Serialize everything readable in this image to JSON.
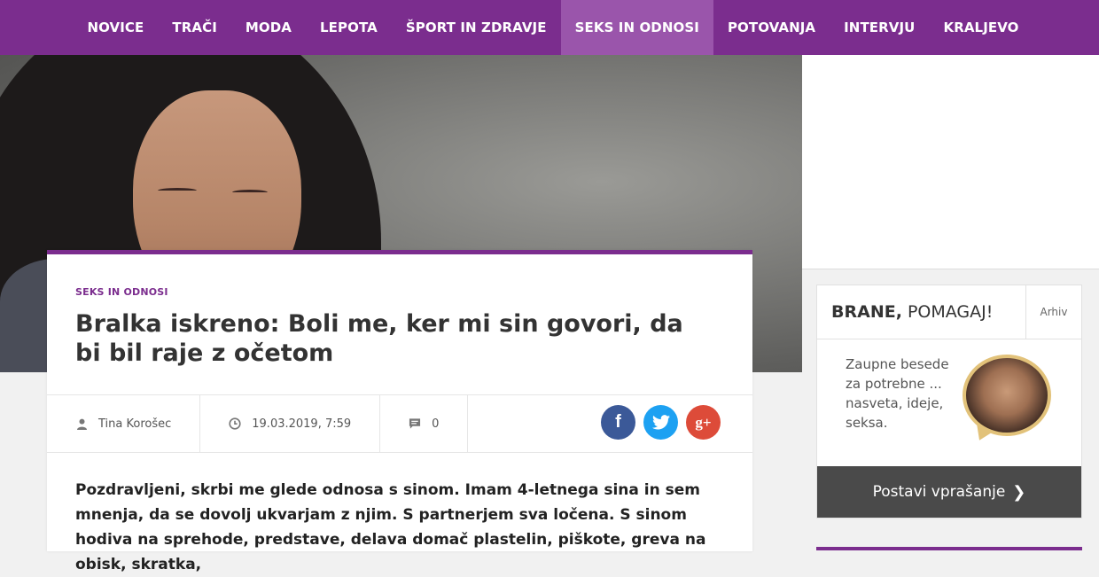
{
  "nav": {
    "items": [
      {
        "label": "NOVICE"
      },
      {
        "label": "TRAČI"
      },
      {
        "label": "MODA"
      },
      {
        "label": "LEPOTA"
      },
      {
        "label": "ŠPORT IN ZDRAVJE"
      },
      {
        "label": "SEKS IN ODNOSI",
        "active": true
      },
      {
        "label": "POTOVANJA"
      },
      {
        "label": "INTERVJU"
      },
      {
        "label": "KRALJEVO"
      }
    ]
  },
  "article": {
    "category": "SEKS IN ODNOSI",
    "title": "Bralka iskreno: Boli me, ker mi sin govori, da bi bil raje z očetom",
    "author": "Tina Korošec",
    "date": "19.03.2019, 7:59",
    "comments": "0",
    "body": "Pozdravljeni, skrbi me glede odnosa s sinom. Imam 4-letnega sina in sem mnenja, da se dovolj ukvarjam z njim. S partnerjem sva ločena. S sinom hodiva na sprehode, predstave, delava domač plastelin, piškote, greva na obisk, skratka,"
  },
  "share": {
    "facebook": "f",
    "google": "g+"
  },
  "sidebar": {
    "brane_name": "BRANE,",
    "brane_sub": " POMAGAJ!",
    "archive": "Arhiv",
    "text": "Zaupne besede za potrebne ... nasveta, ideje, seksa.",
    "button": "Postavi vprašanje"
  },
  "colors": {
    "brand": "#7b2d8e",
    "nav_active": "#9a55ab",
    "facebook": "#3b5998",
    "twitter": "#1da1f2",
    "google": "#dd4b39"
  },
  "icons": {
    "author": "user-icon",
    "date": "clock-icon",
    "comments": "comment-icon",
    "button": "chevron-right-icon"
  }
}
